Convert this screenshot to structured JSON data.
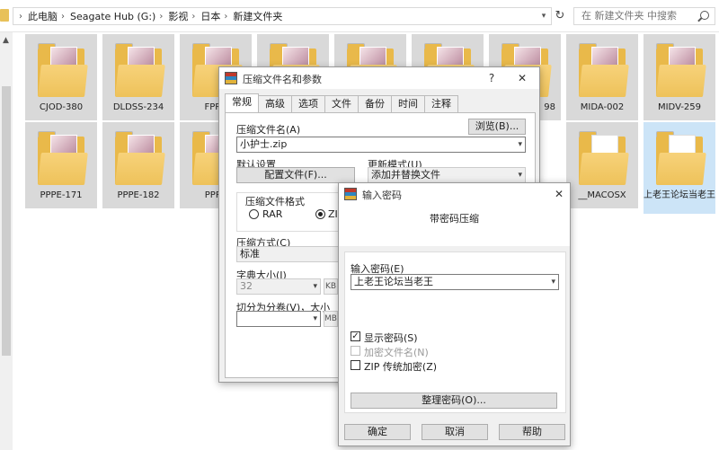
{
  "explorer": {
    "breadcrumbs": [
      "此电脑",
      "Seagate Hub (G:)",
      "影视",
      "日本",
      "新建文件夹"
    ],
    "search_placeholder": "在 新建文件夹 中搜索",
    "folders": [
      {
        "label": "CJOD-380"
      },
      {
        "label": "DLDSS-234"
      },
      {
        "label": "FPRE"
      },
      {
        "label": ""
      },
      {
        "label": ""
      },
      {
        "label": ""
      },
      {
        "label": "98"
      },
      {
        "label": "MIDA-002"
      },
      {
        "label": "MIDV-259"
      },
      {
        "label": "PPPE-171"
      },
      {
        "label": "PPPE-182"
      },
      {
        "label": "PPPE"
      },
      {
        "label": "__MACOSX"
      },
      {
        "label": "上老王论坛当老王"
      }
    ]
  },
  "compress_dialog": {
    "title": "压缩文件名和参数",
    "help_glyph": "?",
    "close_glyph": "✕",
    "tabs": [
      "常规",
      "高级",
      "选项",
      "文件",
      "备份",
      "时间",
      "注释"
    ],
    "archive_name_label": "压缩文件名(A)",
    "browse_button": "浏览(B)...",
    "archive_name_value": "小护士.zip",
    "default_settings_label": "默认设置",
    "profiles_button": "配置文件(F)...",
    "update_mode_label": "更新模式(U)",
    "update_mode_value": "添加并替换文件",
    "format_label": "压缩文件格式",
    "format_rar": "RAR",
    "format_zip": "ZIP",
    "method_label": "压缩方式(C)",
    "method_value": "标准",
    "dict_label": "字典大小(I)",
    "dict_value": "32",
    "dict_unit": "KB",
    "split_label": "切分为分卷(V)，大小",
    "split_unit": "MB"
  },
  "password_dialog": {
    "title": "输入密码",
    "close_glyph": "✕",
    "heading": "带密码压缩",
    "password_label": "输入密码(E)",
    "password_value": "上老王论坛当老王",
    "show_password": "显示密码(S)",
    "encrypt_names": "加密文件名(N)",
    "zip_legacy": "ZIP 传统加密(Z)",
    "organize_button": "整理密码(O)...",
    "ok_button": "确定",
    "cancel_button": "取消",
    "help_button": "帮助"
  }
}
